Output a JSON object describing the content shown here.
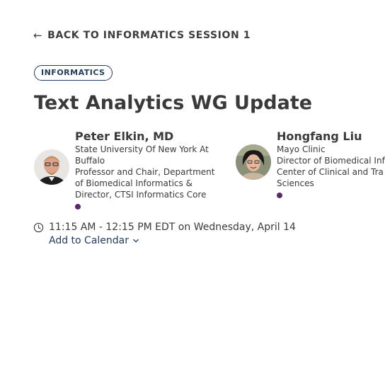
{
  "nav": {
    "back_arrow": "←",
    "back_label": "BACK TO INFORMATICS SESSION 1"
  },
  "session": {
    "tag": "INFORMATICS",
    "title": "Text Analytics WG Update"
  },
  "speakers": [
    {
      "name": "Peter Elkin, MD",
      "lines": [
        "State University Of New York At",
        "Buffalo",
        "Professor and Chair, Department",
        "of Biomedical Informatics &",
        "Director, CTSI Informatics Core"
      ]
    },
    {
      "name": "Hongfang Liu",
      "lines": [
        "Mayo Clinic",
        "Director of Biomedical Inf",
        "Center of Clinical and Tra",
        "Sciences"
      ]
    }
  ],
  "schedule": {
    "time_text": "11:15 AM - 12:15 PM EDT on Wednesday, April 14",
    "add_calendar": "Add to Calendar"
  },
  "colors": {
    "accent": "#1f3a5f",
    "dot": "#5b2a6e",
    "text": "#3a3a3a"
  }
}
